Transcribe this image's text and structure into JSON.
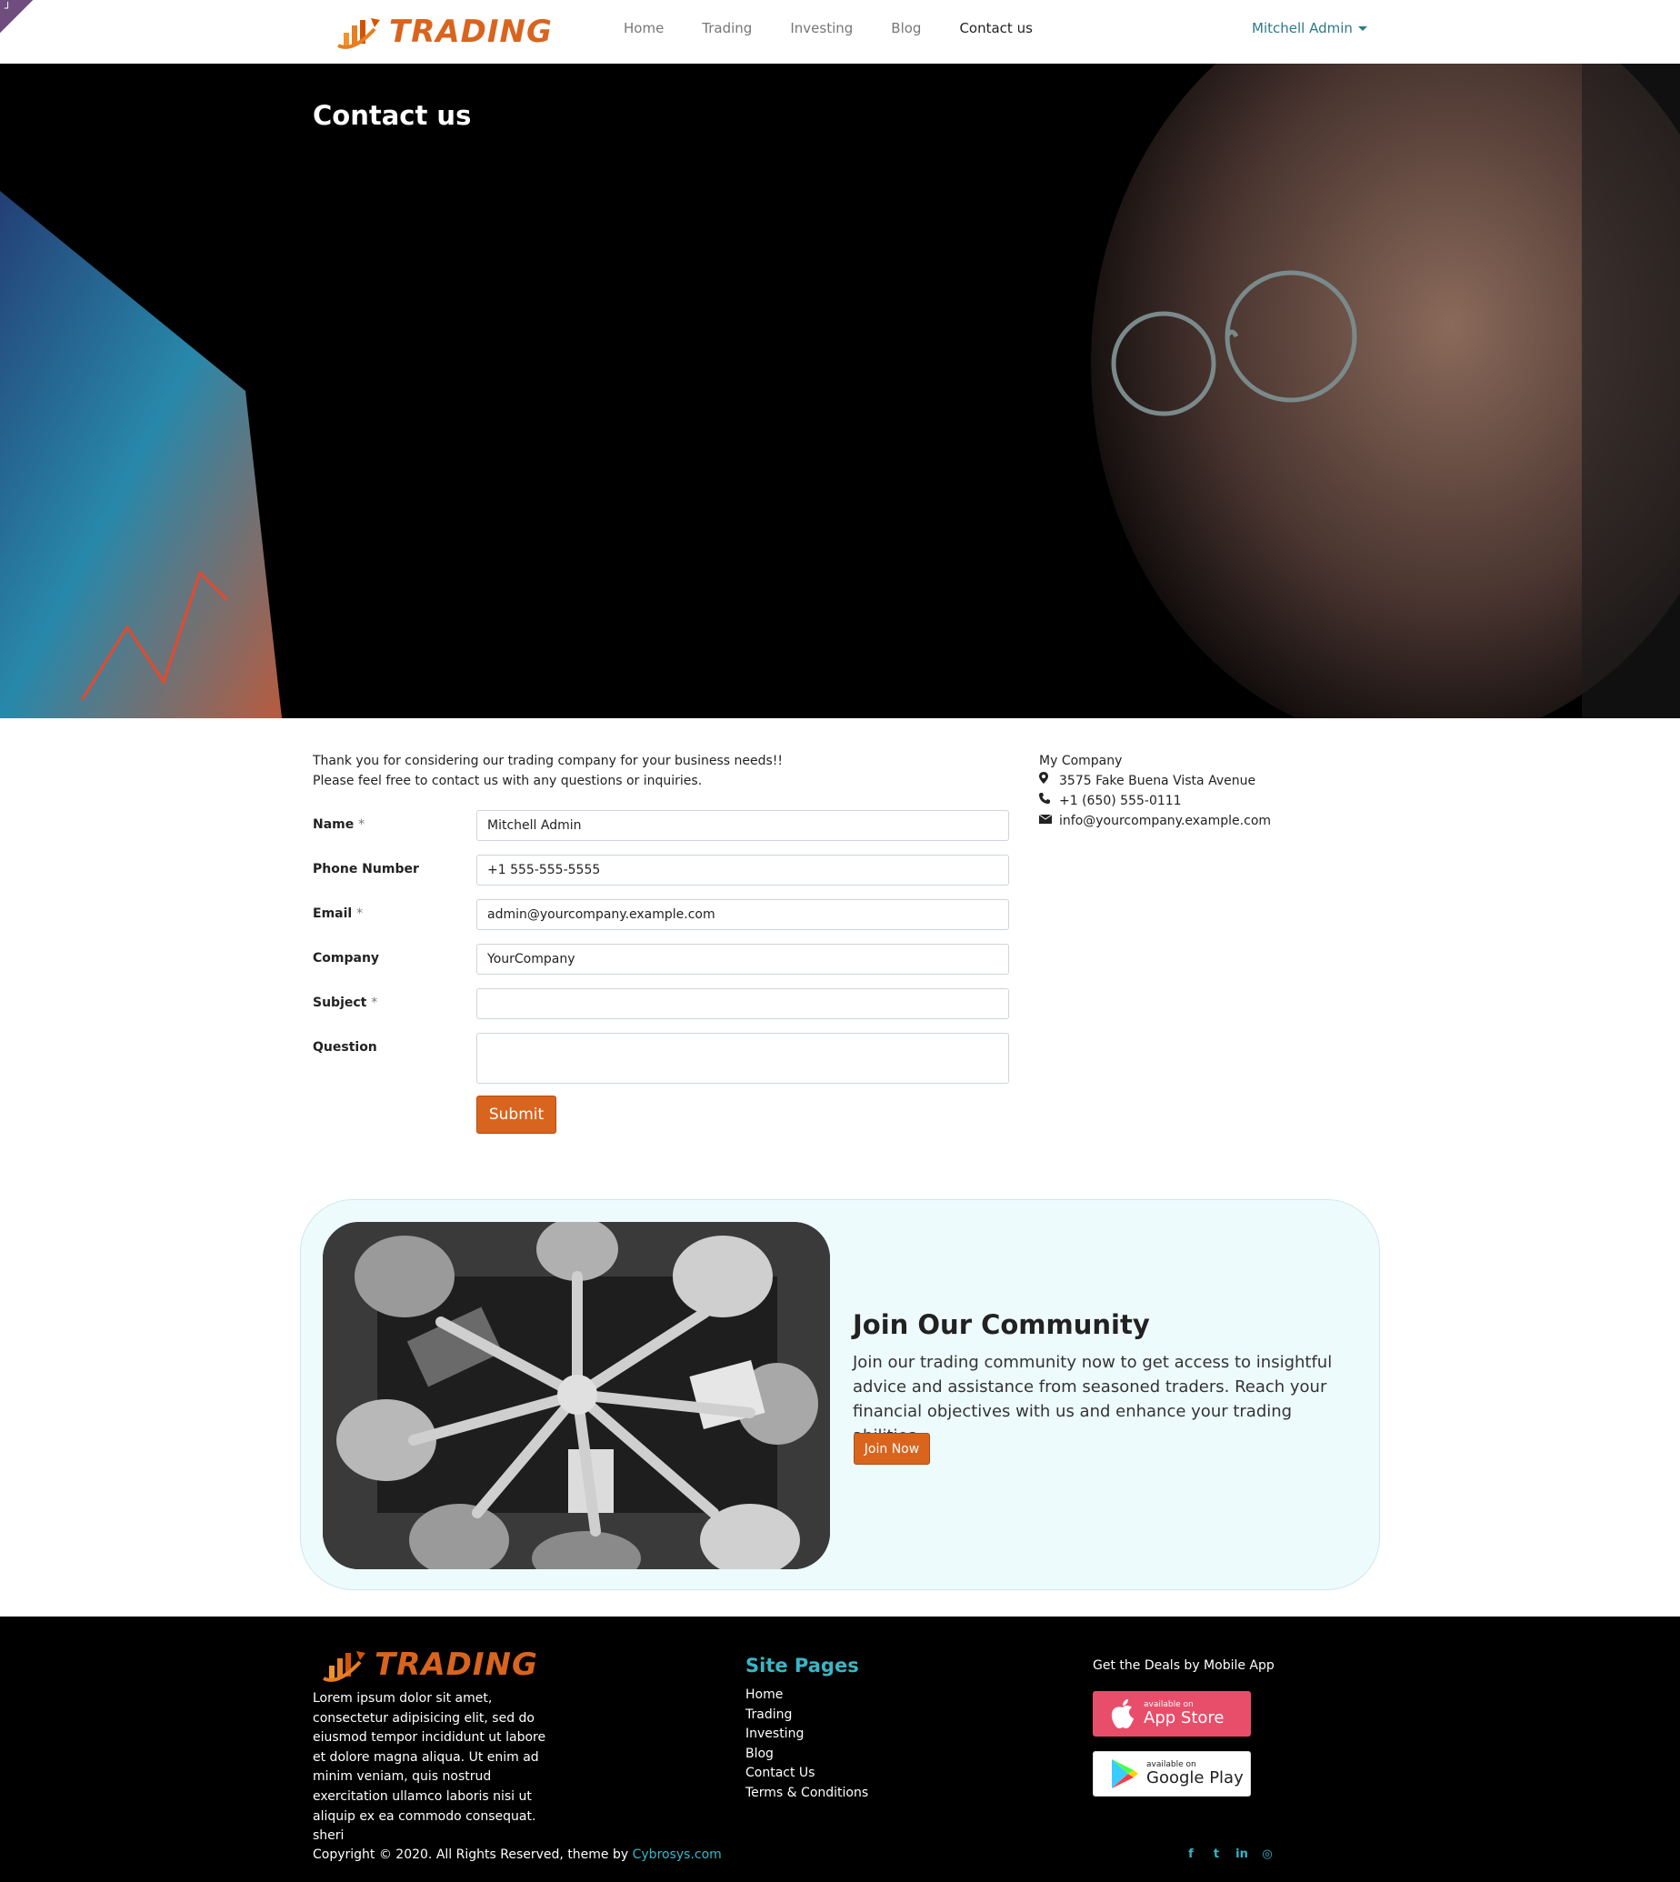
{
  "header": {
    "corner_icon": "edit-corner-icon",
    "logo_text": "TRADING",
    "nav": [
      {
        "label": "Home",
        "active": false
      },
      {
        "label": "Trading",
        "active": false
      },
      {
        "label": "Investing",
        "active": false
      },
      {
        "label": "Blog",
        "active": false
      },
      {
        "label": "Contact us",
        "active": true
      }
    ],
    "user_label": "Mitchell Admin"
  },
  "hero": {
    "title": "Contact us"
  },
  "contact": {
    "intro_line1": "Thank you for considering our trading company for your business needs!!",
    "intro_line2": "Please feel free to contact us with any questions or inquiries.",
    "fields": {
      "name": {
        "label": "Name",
        "required": "*",
        "value": "Mitchell Admin"
      },
      "phone": {
        "label": "Phone Number",
        "value": "+1 555-555-5555"
      },
      "email": {
        "label": "Email",
        "required": "*",
        "value": "admin@yourcompany.example.com"
      },
      "company": {
        "label": "Company",
        "value": "YourCompany"
      },
      "subject": {
        "label": "Subject",
        "required": "*",
        "value": ""
      },
      "question": {
        "label": "Question",
        "value": ""
      }
    },
    "submit_label": "Submit"
  },
  "company_info": {
    "name": "My Company",
    "address": "3575 Fake Buena Vista Avenue",
    "phone": "+1 (650) 555-0111",
    "email": "info@yourcompany.example.com",
    "icons": [
      "map-marker-icon",
      "phone-icon",
      "envelope-icon"
    ]
  },
  "community": {
    "title": "Join Our Community",
    "text": "Join our trading community now to get access to insightful advice and assistance from seasoned traders. Reach your financial objectives with us and enhance your trading abilities.",
    "button_label": "Join Now"
  },
  "footer": {
    "logo_text": "TRADING",
    "about": "Lorem ipsum dolor sit amet, consectetur adipisicing elit, sed do eiusmod tempor incididunt ut labore et dolore magna aliqua. Ut enim ad minim veniam, quis nostrud exercitation ullamco laboris nisi ut aliquip ex ea commodo consequat. sheri",
    "site_pages_title": "Site Pages",
    "site_pages": [
      "Home",
      "Trading",
      "Investing",
      "Blog",
      "Contact Us",
      "Terms & Conditions"
    ],
    "app_title": "Get the Deals by Mobile App",
    "app_store": {
      "small": "available on",
      "big": "App Store"
    },
    "google_play": {
      "small": "available on",
      "big": "Google Play"
    },
    "copyright_text": "Copyright © 2020. All Rights Reserved, theme by ",
    "copyright_link": "Cybrosys.com",
    "socials": [
      "facebook-icon",
      "twitter-icon",
      "linkedin-icon",
      "instagram-icon"
    ],
    "social_glyphs": [
      "f",
      "t",
      "in",
      "◎"
    ]
  },
  "colors": {
    "accent": "#d9641e",
    "teal": "#38b6c7",
    "user_link": "#2c7b83",
    "community_bg": "#eefbfd",
    "app_store_bg": "#e84e6a"
  }
}
